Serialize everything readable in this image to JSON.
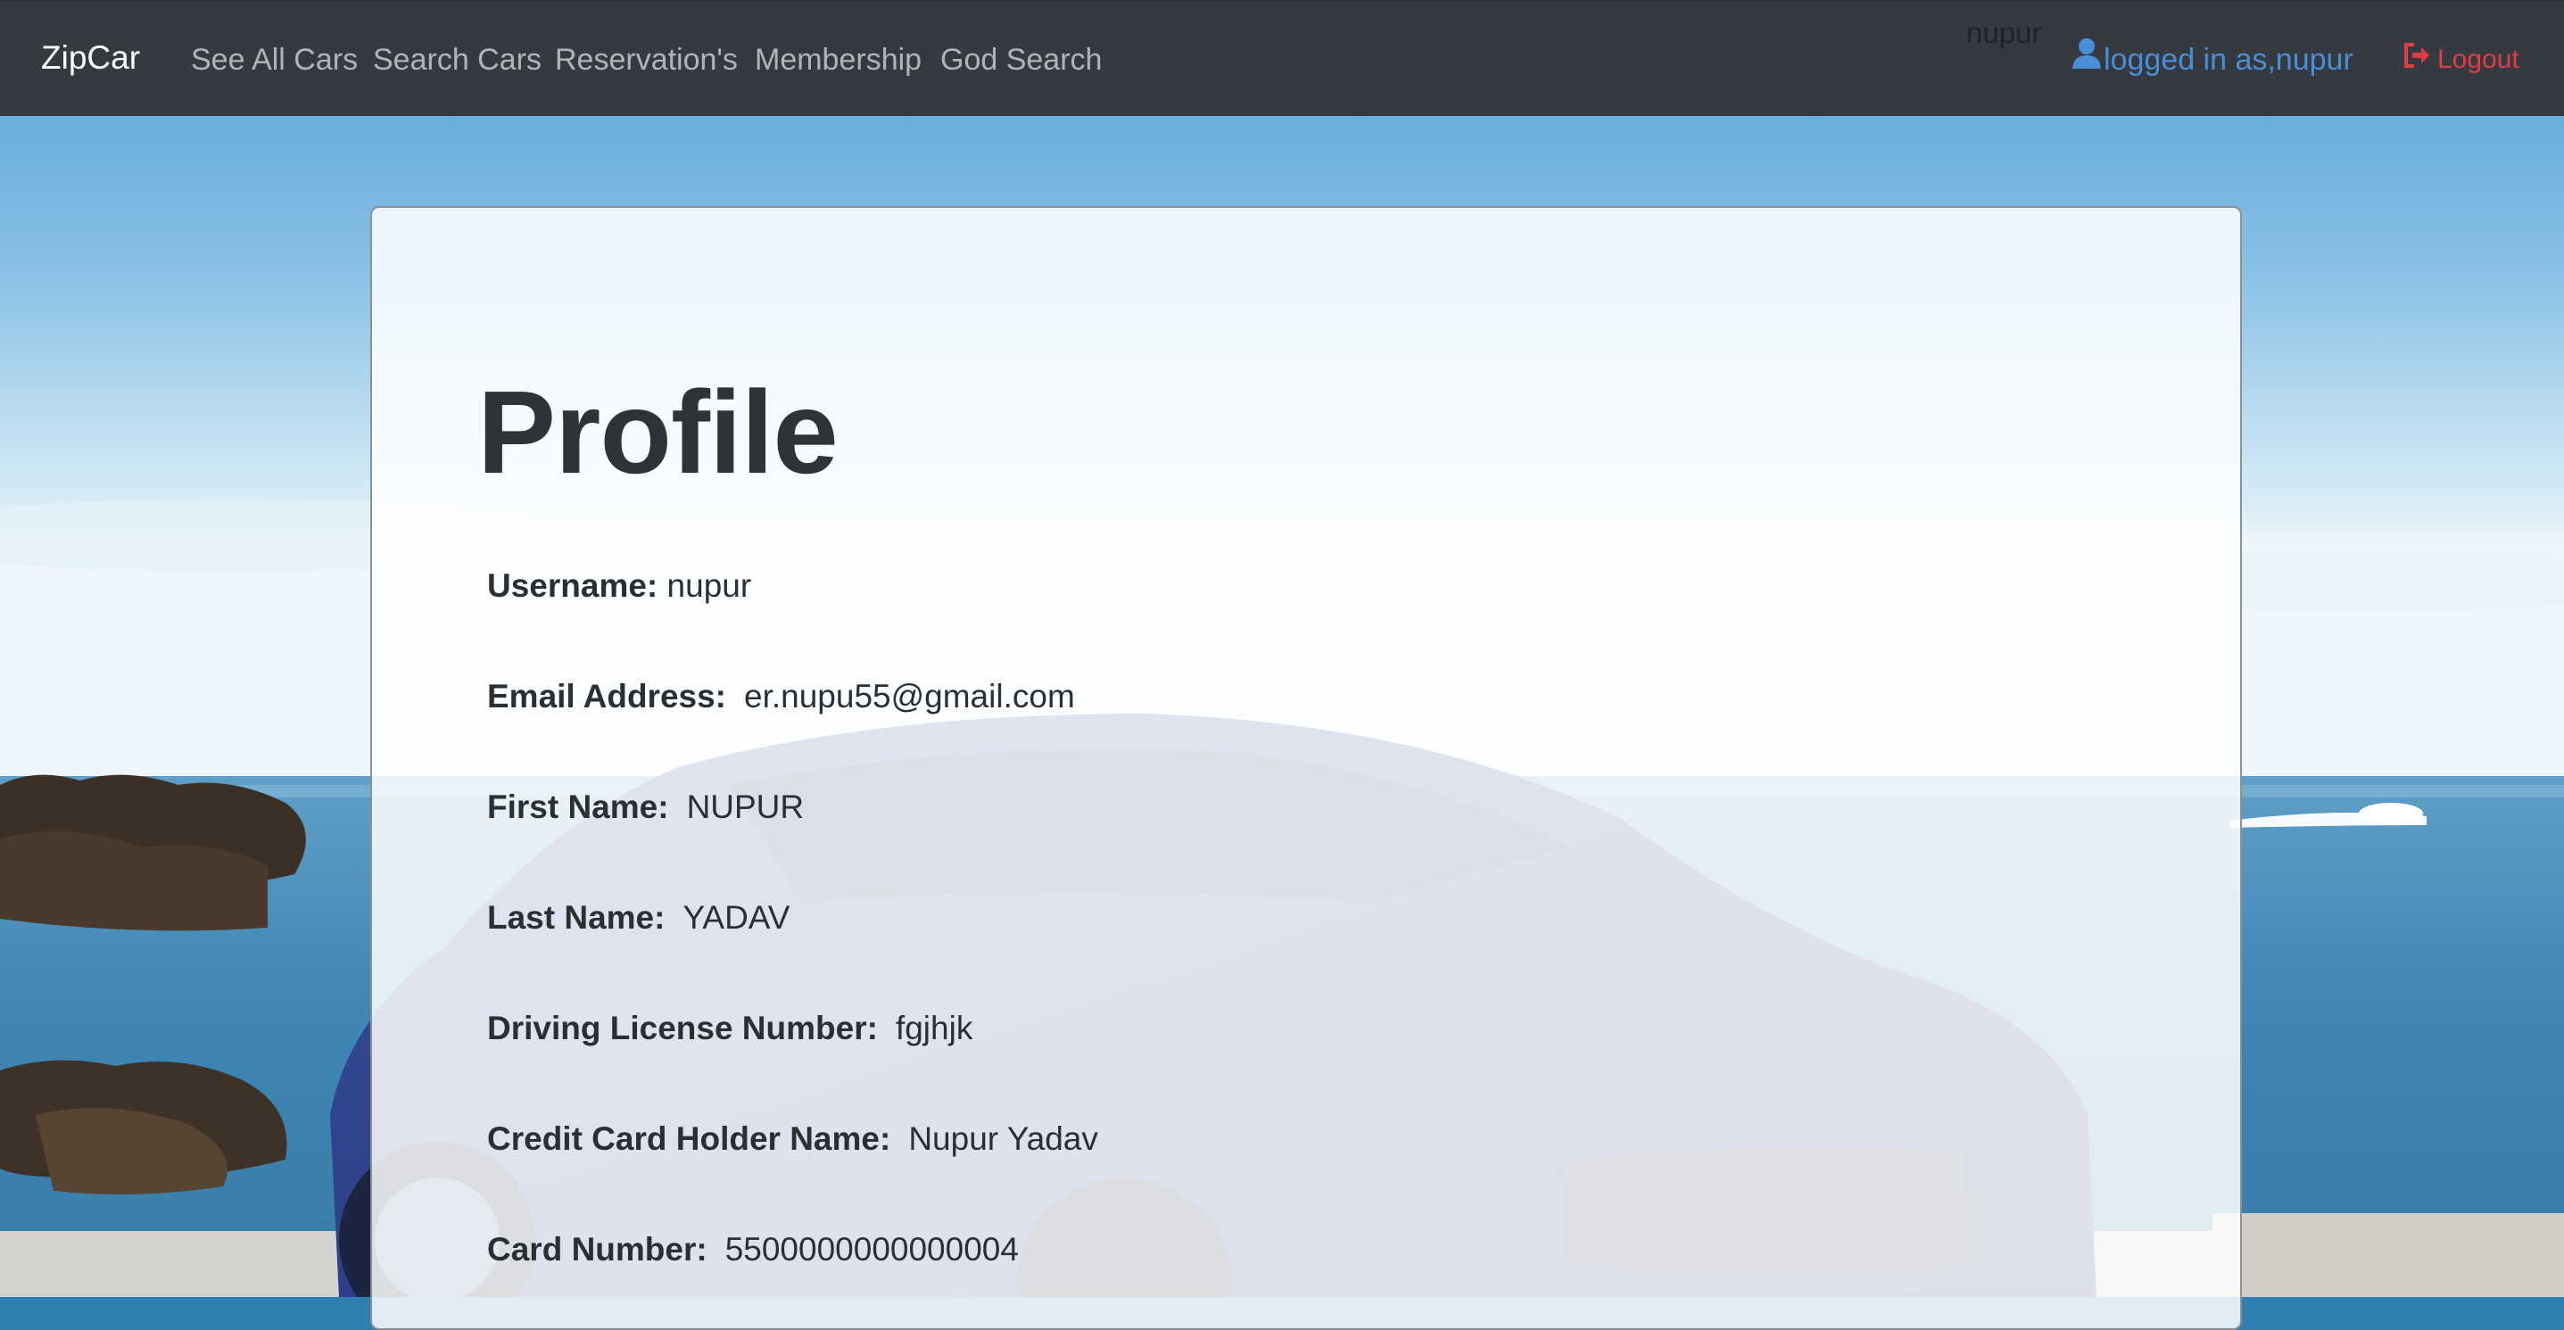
{
  "navbar": {
    "brand": "ZipCar",
    "links": [
      {
        "label": "See All Cars"
      },
      {
        "label": "Search Cars"
      },
      {
        "label": "Reservation's"
      },
      {
        "label": "Membership"
      },
      {
        "label": "God Search"
      }
    ],
    "faint_username": "nupur",
    "user_label": "logged in as,nupur",
    "logout_label": "Logout",
    "colors": {
      "bar": "#343a40",
      "user_link": "#4a8fd6",
      "logout": "#e03d49"
    },
    "icons": {
      "user": "user-icon",
      "logout": "logout-icon"
    }
  },
  "profile": {
    "title": "Profile",
    "fields": [
      {
        "label": "Username:",
        "value": "nupur"
      },
      {
        "label": "Email Address:",
        "value": "er.nupu55@gmail.com"
      },
      {
        "label": "First Name:",
        "value": "NUPUR"
      },
      {
        "label": "Last Name:",
        "value": "YADAV"
      },
      {
        "label": "Driving License Number:",
        "value": "fgjhjk"
      },
      {
        "label": "Credit Card Holder Name:",
        "value": "Nupur Yadav"
      },
      {
        "label": "Card Number:",
        "value": "5500000000000004"
      }
    ]
  }
}
